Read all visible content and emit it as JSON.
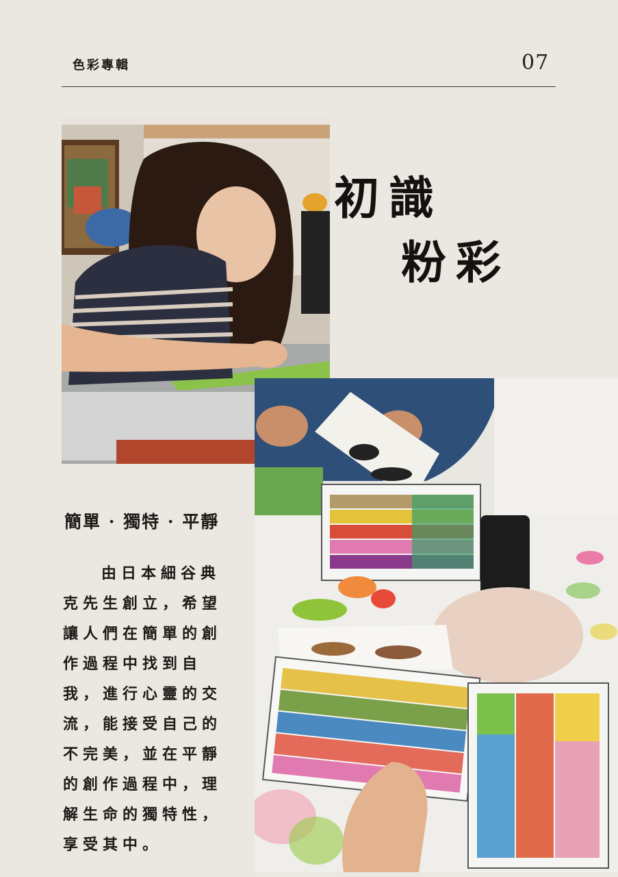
{
  "header": {
    "section": "色彩專輯",
    "page_number": "07"
  },
  "title": {
    "line1": "初識",
    "line2": "粉彩"
  },
  "subheading": "簡單 · 獨特 · 平靜",
  "body_lines": [
    "由日本細谷典",
    "克先生創立，希望",
    "讓人們在簡單的創",
    "作過程中找到自",
    "我，進行心靈的交",
    "流，能接受自己的",
    "不完美，並在平靜",
    "的創作過程中，理",
    "解生命的獨特性，",
    "享受其中。"
  ]
}
